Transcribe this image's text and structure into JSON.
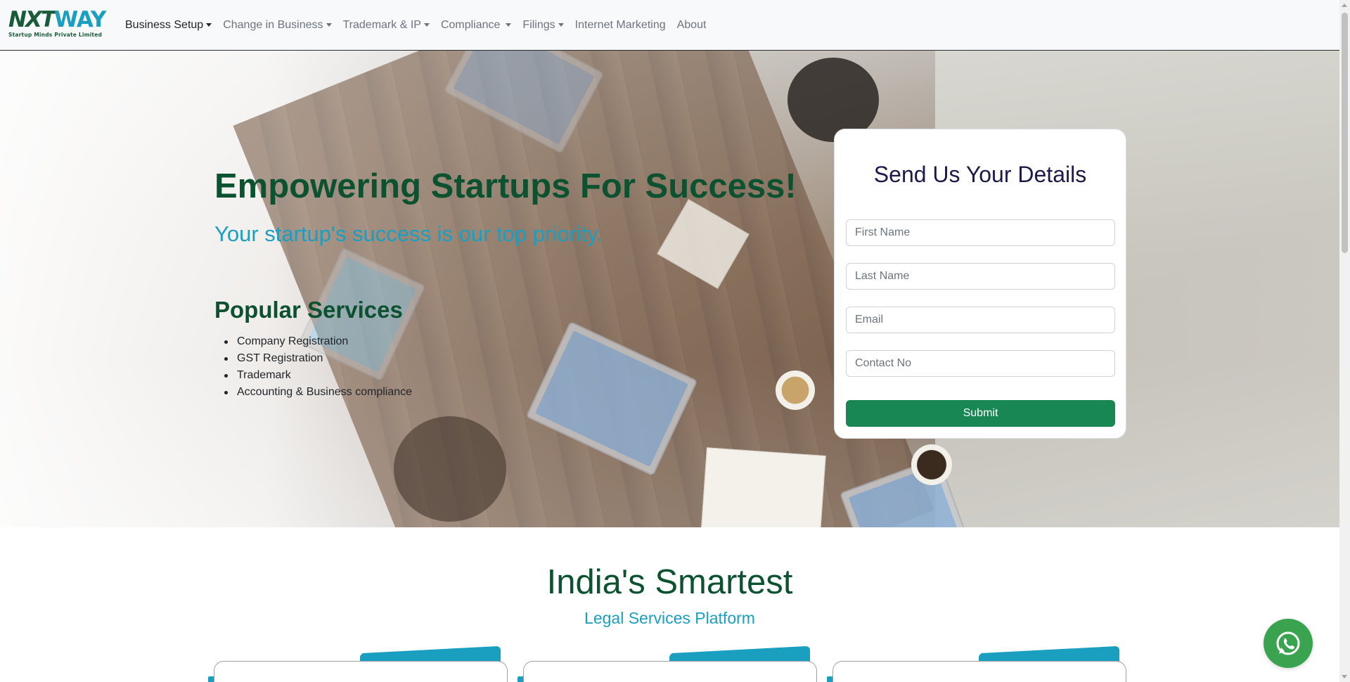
{
  "brand": {
    "logo_nx": "NX",
    "logo_t": "T",
    "logo_way": "WAY",
    "tagline": "Startup Minds Private Limited",
    "colors": {
      "primary_green": "#0d5230",
      "accent_teal": "#1a9fc0",
      "button_green": "#198754",
      "whatsapp_green": "#3aa34f"
    }
  },
  "nav": {
    "items": [
      {
        "label": "Business Setup",
        "has_dropdown": true,
        "active": true
      },
      {
        "label": "Change in Business",
        "has_dropdown": true,
        "active": false
      },
      {
        "label": "Trademark & IP",
        "has_dropdown": true,
        "active": false
      },
      {
        "label": "Compliance",
        "has_dropdown": true,
        "active": false
      },
      {
        "label": "Filings",
        "has_dropdown": true,
        "active": false
      },
      {
        "label": "Internet Marketing",
        "has_dropdown": false,
        "active": false
      },
      {
        "label": "About",
        "has_dropdown": false,
        "active": false
      }
    ]
  },
  "hero": {
    "title": "Empowering Startups For Success!",
    "subtitle": "Your startup's success is our top priority.",
    "services_title": "Popular Services",
    "services": [
      "Company Registration",
      "GST Registration",
      "Trademark",
      "Accounting & Business compliance"
    ]
  },
  "form": {
    "title": "Send Us Your Details",
    "first_name_placeholder": "First Name",
    "last_name_placeholder": "Last Name",
    "email_placeholder": "Email",
    "contact_placeholder": "Contact No",
    "submit_label": "Submit"
  },
  "section2": {
    "title": "India's Smartest",
    "subtitle": "Legal Services Platform"
  },
  "icons": {
    "whatsapp": "whatsapp-icon"
  }
}
